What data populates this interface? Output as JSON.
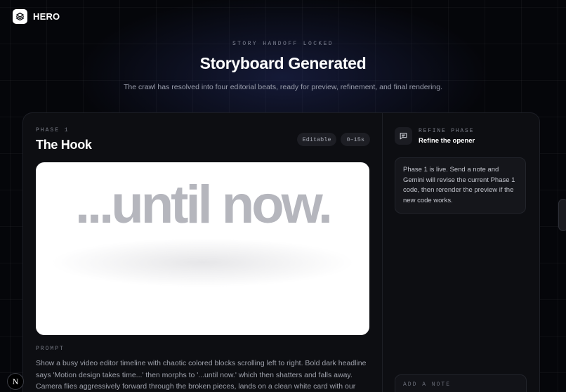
{
  "app": {
    "brand": "HERO",
    "logo_icon": "layers-icon"
  },
  "header": {
    "eyebrow": "STORY HANDOFF LOCKED",
    "title": "Storyboard Generated",
    "subtitle": "The crawl has resolved into four editorial beats, ready for preview, refinement, and final rendering."
  },
  "phase": {
    "label": "PHASE 1",
    "title": "The Hook",
    "chips": [
      "Editable",
      "0–15s"
    ],
    "preview_text": "...until now.",
    "prompt_label": "PROMPT",
    "prompt_text": "Show a busy video editor timeline with chaotic colored blocks scrolling left to right. Bold dark headline says 'Motion design takes time...' then morphs to '...until now.' which then shatters and falls away. Camera flies aggressively forward through the broken pieces, lands on a clean white card with our"
  },
  "refine": {
    "icon": "chat-bubble-icon",
    "eyebrow": "REFINE PHASE",
    "title": "Refine the opener",
    "message": "Phase 1 is live. Send a note and Gemini will revise the current Phase 1 code, then rerender the preview if the new code works.",
    "note_label": "ADD A NOTE"
  },
  "overlay": {
    "n_badge": "N"
  },
  "colors": {
    "background": "#05060a",
    "card": "#0d0e12",
    "preview_bg": "#ffffff",
    "preview_text": "#b5b6bd"
  }
}
